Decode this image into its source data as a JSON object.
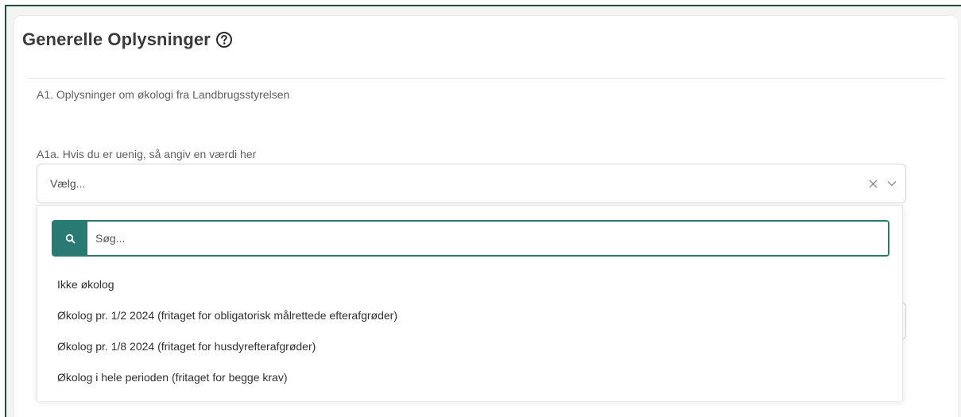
{
  "card": {
    "title": "Generelle Oplysninger",
    "section_label": "A1. Oplysninger om økologi fra Landbrugsstyrelsen"
  },
  "field": {
    "label": "A1a. Hvis du er uenig, så angiv en værdi her",
    "selected_value": "Vælg..."
  },
  "dropdown": {
    "search_placeholder": "Søg...",
    "options": [
      "Ikke økolog",
      "Økolog pr. 1/2 2024 (fritaget for obligatorisk målrettede efterafgrøder)",
      "Økolog pr. 1/8 2024 (fritaget for husdyrefterafgrøder)",
      "Økolog i hele perioden (fritaget for begge krav)"
    ]
  },
  "icons": {
    "help": "question-circle-icon",
    "clear": "close-icon",
    "expand": "chevron-down-icon",
    "search": "search-icon"
  },
  "colors": {
    "accent": "#2a7a74",
    "frame": "#1f4d3a"
  }
}
